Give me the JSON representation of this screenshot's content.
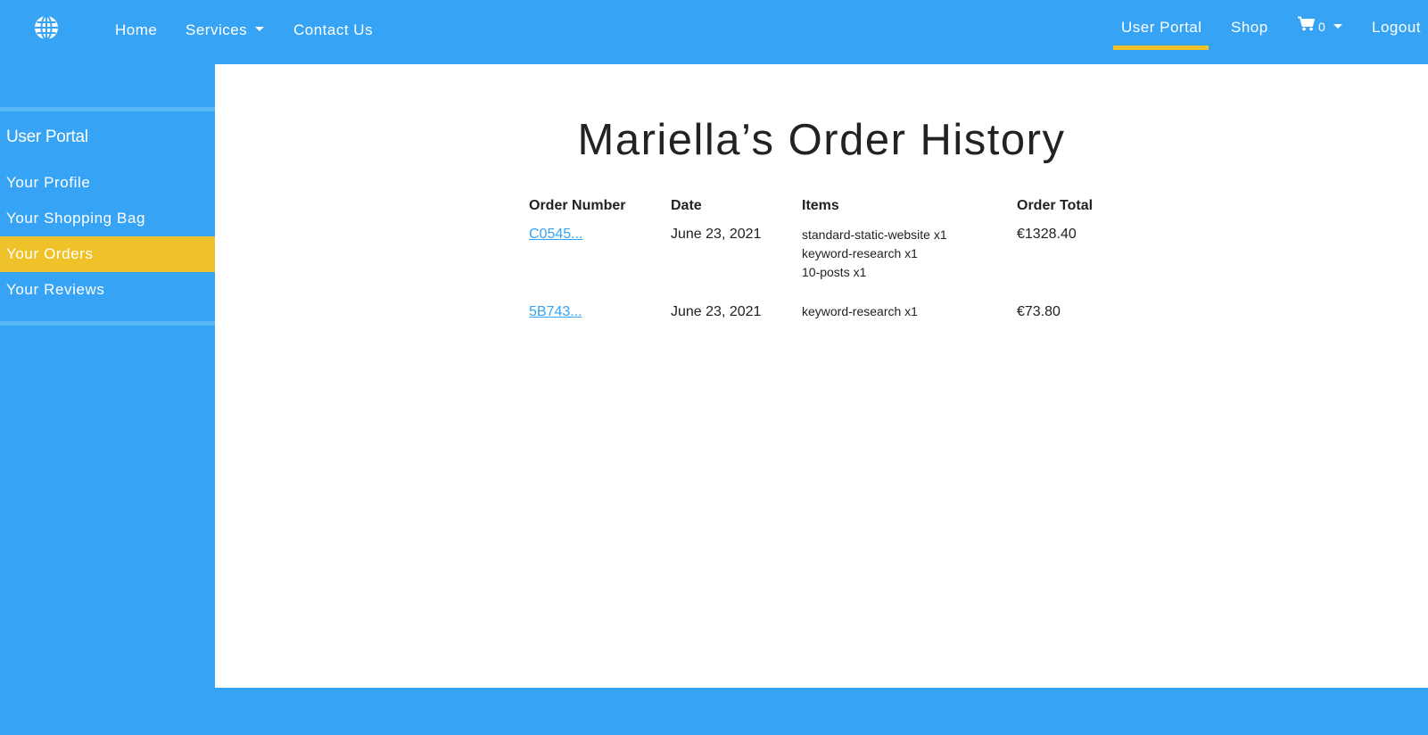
{
  "nav": {
    "logo_icon": "globe-icon",
    "left": [
      "Home",
      "Services",
      "Contact Us"
    ],
    "right": {
      "user_portal": "User Portal",
      "shop": "Shop",
      "cart_icon": "shopping-cart-icon",
      "cart_count": "0",
      "logout": "Logout"
    },
    "accent_color": "#f0c22a",
    "bg_color": "#36a3f5"
  },
  "sidebar": {
    "title": "User Portal",
    "items": [
      {
        "label": "Your Profile",
        "active": false
      },
      {
        "label": "Your Shopping Bag",
        "active": false
      },
      {
        "label": "Your Orders",
        "active": true
      },
      {
        "label": "Your Reviews",
        "active": false
      }
    ]
  },
  "main": {
    "title": "Mariella’s Order History",
    "columns": [
      "Order Number",
      "Date",
      "Items",
      "Order Total"
    ],
    "orders": [
      {
        "number": "C0545...",
        "date": "June 23, 2021",
        "items": [
          "standard-static-website x1",
          "keyword-research x1",
          "10-posts x1"
        ],
        "total": "€1328.40"
      },
      {
        "number": "5B743...",
        "date": "June 23, 2021",
        "items": [
          "keyword-research x1"
        ],
        "total": "€73.80"
      }
    ]
  }
}
